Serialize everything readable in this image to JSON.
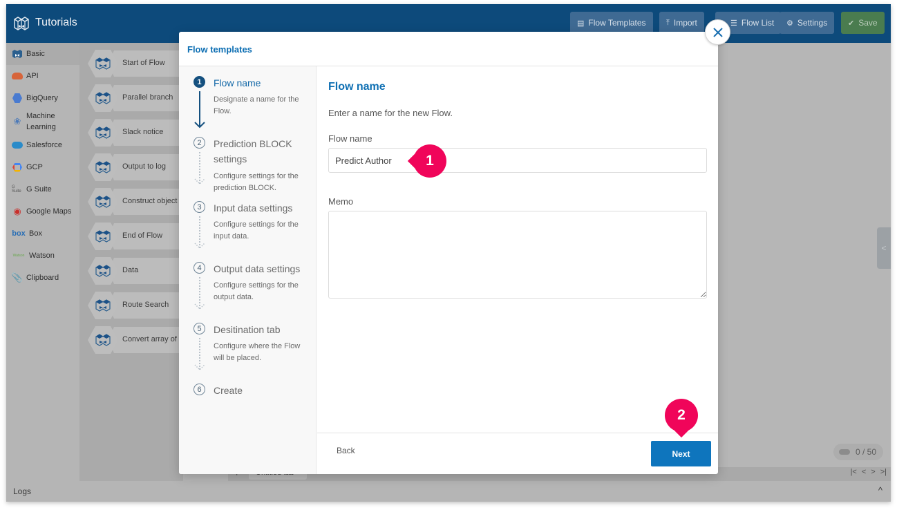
{
  "app": {
    "title": "Tutorials",
    "brand_color": "#0d4a7b",
    "header_buttons": [
      {
        "label": "Flow Templates",
        "icon": "list-icon"
      },
      {
        "label": "Import",
        "icon": "upload-icon"
      },
      {
        "label": "Flow List",
        "icon": "menu-icon"
      },
      {
        "label": "Settings",
        "icon": "gear-icon"
      },
      {
        "label": "Save",
        "icon": "check-circle-icon"
      }
    ]
  },
  "sidebar": {
    "items": [
      {
        "label": "Basic",
        "icon": "block-icon",
        "active": true
      },
      {
        "label": "API",
        "icon": "cloud-api-icon"
      },
      {
        "label": "BigQuery",
        "icon": "bigquery-icon"
      },
      {
        "label": "Machine Learning",
        "icon": "brain-icon"
      },
      {
        "label": "Salesforce",
        "icon": "salesforce-cloud-icon"
      },
      {
        "label": "GCP",
        "icon": "gcp-hexagon-icon"
      },
      {
        "label": "G Suite",
        "icon": "gsuite-icon",
        "icon_text": "G Suite"
      },
      {
        "label": "Google Maps",
        "icon": "map-pin-icon"
      },
      {
        "label": "Box",
        "icon": "box-logo-icon",
        "icon_text": "box"
      },
      {
        "label": "Watson",
        "icon": "watson-logo-icon",
        "icon_text": "Watson"
      },
      {
        "label": "Clipboard",
        "icon": "paperclip-icon"
      }
    ]
  },
  "palette": {
    "blocks": [
      "Start of Flow",
      "Parallel branch",
      "Slack notice",
      "Output to log",
      "Construct object",
      "End of Flow",
      "Data",
      "Route Search",
      "Convert array of o"
    ]
  },
  "canvas": {
    "counter": "0 / 50",
    "tab_add": "+",
    "tab_label": "Untitled tab",
    "tab_close": "×",
    "nav": [
      "|<",
      "<",
      ">",
      ">|"
    ],
    "collapse_handle": "<"
  },
  "logs": {
    "label": "Logs",
    "toggle": "^"
  },
  "modal": {
    "title": "Flow templates",
    "close": "×",
    "steps": [
      {
        "number": "1",
        "name": "Flow name",
        "desc": "Designate a name for the Flow.",
        "active": true
      },
      {
        "number": "2",
        "name": "Prediction BLOCK settings",
        "desc": "Configure settings for the prediction BLOCK."
      },
      {
        "number": "3",
        "name": "Input data settings",
        "desc": "Configure settings for the input data."
      },
      {
        "number": "4",
        "name": "Output data settings",
        "desc": "Configure settings for the output data."
      },
      {
        "number": "5",
        "name": "Desitination tab",
        "desc": "Configure where the Flow will be placed."
      },
      {
        "number": "6",
        "name": "Create",
        "desc": ""
      }
    ],
    "content": {
      "title": "Flow name",
      "description": "Enter a name for the new Flow.",
      "flow_name_label": "Flow name",
      "flow_name_value": "Predict Author",
      "memo_label": "Memo",
      "memo_value": ""
    },
    "footer": {
      "back": "Back",
      "next": "Next"
    }
  },
  "annotations": [
    {
      "number": "1",
      "color": "#f0055a"
    },
    {
      "number": "2",
      "color": "#f0055a"
    }
  ]
}
